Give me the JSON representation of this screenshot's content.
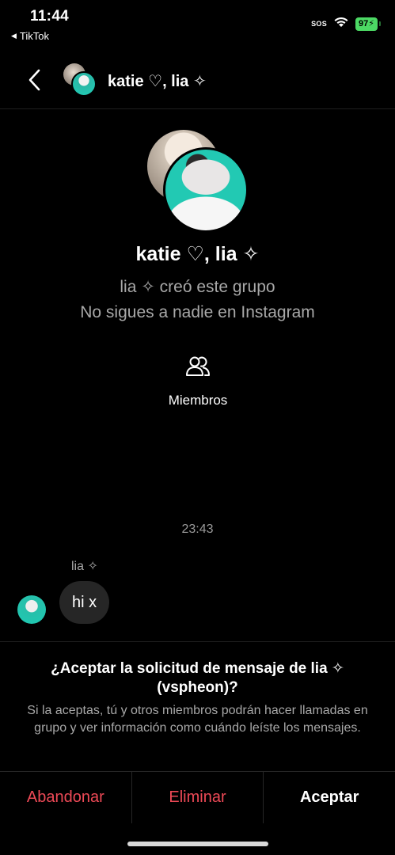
{
  "status_bar": {
    "time": "11:44",
    "back_app": "TikTok",
    "sos": "SOS",
    "battery": "97"
  },
  "header": {
    "title": "katie ♡, lia ✧",
    "back_icon": "chevron-left-icon"
  },
  "group": {
    "name": "katie ♡, lia ✧",
    "created_by": "lia ✧ creó este grupo",
    "follow_info": "No sigues a nadie en Instagram",
    "members_label": "Miembros",
    "members_icon": "people-icon"
  },
  "conversation": {
    "timestamp": "23:43",
    "messages": [
      {
        "sender": "lia ✧",
        "text": "hi x"
      }
    ]
  },
  "request": {
    "title": "¿Aceptar la solicitud de mensaje de lia ✧ (vspheon)?",
    "body": "Si la aceptas, tú y otros miembros podrán hacer llamadas en grupo y ver información como cuándo leíste los mensajes."
  },
  "actions": {
    "leave": "Abandonar",
    "delete": "Eliminar",
    "accept": "Aceptar"
  },
  "colors": {
    "background": "#000000",
    "danger": "#ed4956",
    "bubble": "#262626",
    "battery": "#4cd964",
    "muted_text": "#a8a8a8"
  }
}
